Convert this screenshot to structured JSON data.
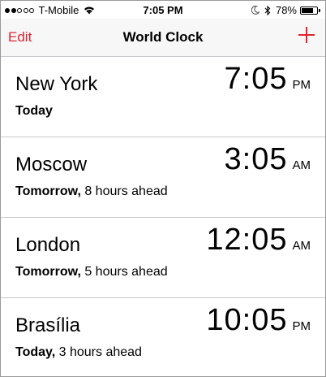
{
  "status_bar": {
    "carrier": "T-Mobile",
    "time": "7:05 PM",
    "battery_pct": "78%",
    "battery_level": 0.78,
    "signal_bars_filled": 2,
    "signal_bars_total": 5
  },
  "nav": {
    "edit_label": "Edit",
    "title": "World Clock",
    "add_icon": "plus-icon",
    "accent_color": "#e0242f"
  },
  "clocks": [
    {
      "city": "New York",
      "time": "7:05",
      "ampm": "PM",
      "day": "Today",
      "offset": ""
    },
    {
      "city": "Moscow",
      "time": "3:05",
      "ampm": "AM",
      "day": "Tomorrow,",
      "offset": " 8 hours ahead"
    },
    {
      "city": "London",
      "time": "12:05",
      "ampm": "AM",
      "day": "Tomorrow,",
      "offset": " 5 hours ahead"
    },
    {
      "city": "Brasília",
      "time": "10:05",
      "ampm": "PM",
      "day": "Today,",
      "offset": " 3 hours ahead"
    }
  ]
}
